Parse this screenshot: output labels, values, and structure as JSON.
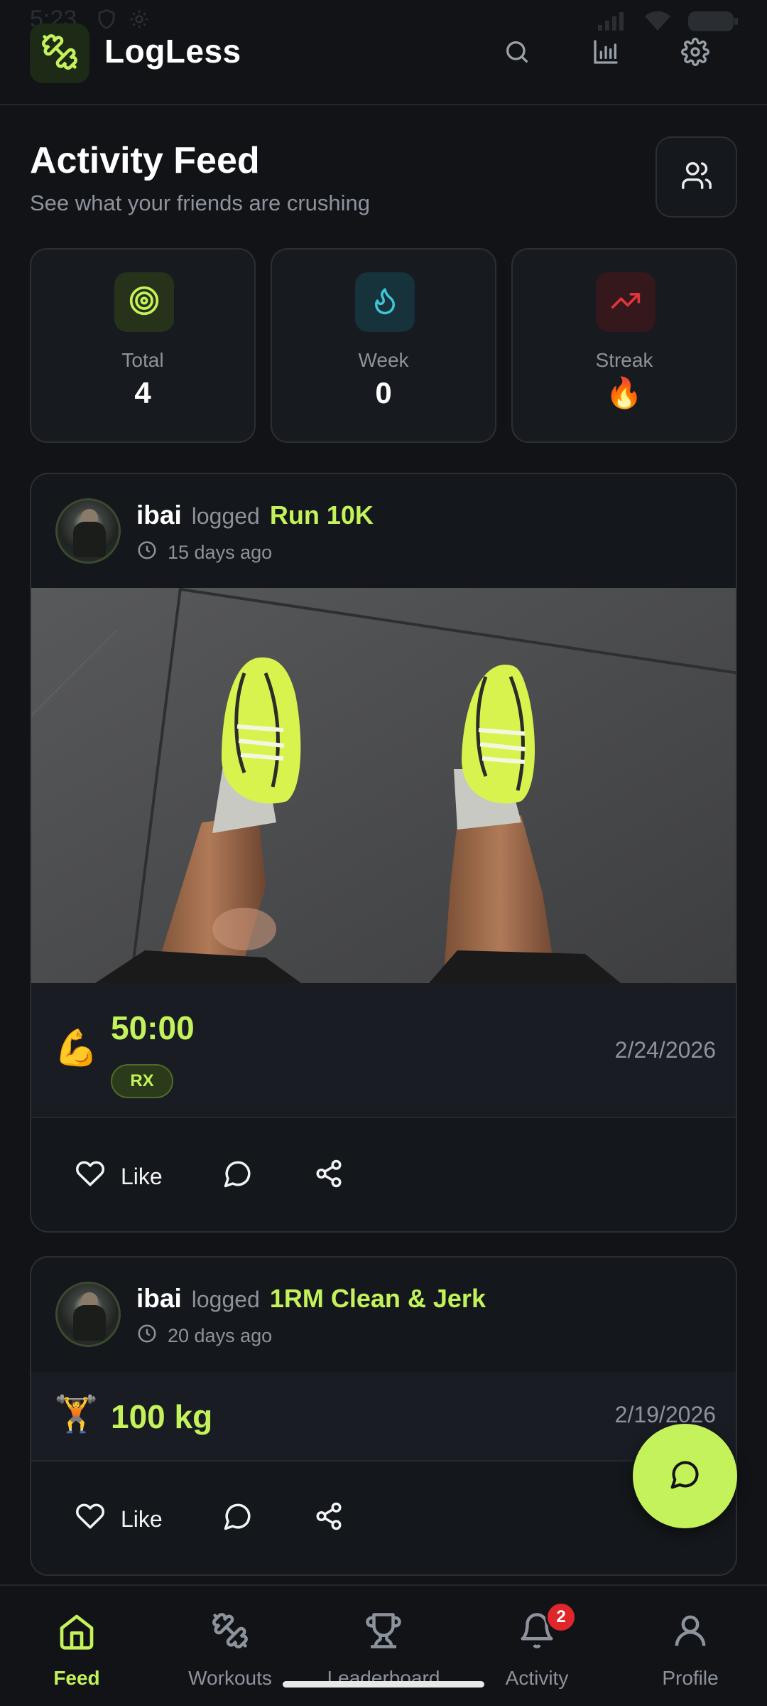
{
  "status_bar": {
    "time": "5:23"
  },
  "header": {
    "app_name": "LogLess"
  },
  "page": {
    "title": "Activity Feed",
    "subtitle": "See what your friends are crushing"
  },
  "stats": [
    {
      "label": "Total",
      "value": "4",
      "icon": "target-icon",
      "color": "#c4f25a"
    },
    {
      "label": "Week",
      "value": "0",
      "icon": "flame-icon",
      "color": "#3ec6d8"
    },
    {
      "label": "Streak",
      "value": "🔥",
      "icon": "trending-up-icon",
      "color": "#e0353a"
    }
  ],
  "posts": [
    {
      "user": "ibai",
      "verb": "logged",
      "workout": "Run 10K",
      "time_ago": "15 days ago",
      "result_emoji": "💪",
      "result": "50:00",
      "badge": "RX",
      "date": "2/24/2026",
      "like_label": "Like"
    },
    {
      "user": "ibai",
      "verb": "logged",
      "workout": "1RM Clean & Jerk",
      "time_ago": "20 days ago",
      "result_emoji": "🏋️",
      "result": "100 kg",
      "date": "2/19/2026",
      "like_label": "Like"
    }
  ],
  "nav": [
    {
      "label": "Feed",
      "active": true
    },
    {
      "label": "Workouts"
    },
    {
      "label": "Leaderboard"
    },
    {
      "label": "Activity",
      "badge": "2"
    },
    {
      "label": "Profile"
    }
  ],
  "colors": {
    "accent": "#c4f25a",
    "background": "#111317",
    "card": "#14171b",
    "badge_red": "#e0262b"
  }
}
